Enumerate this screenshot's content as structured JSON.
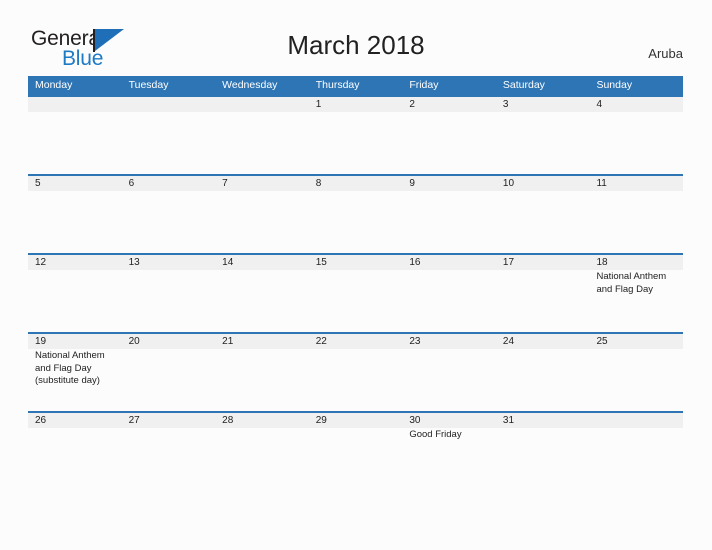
{
  "brand": {
    "name_part1": "General",
    "name_part2": "Blue",
    "flag_icon": "flag-icon"
  },
  "header": {
    "title": "March 2018",
    "country": "Aruba"
  },
  "colors": {
    "header_blue": "#2e75b6",
    "row_divider_blue": "#2e75b6",
    "daynum_band": "#f0f0f0",
    "logo_blue": "#1f7ac4",
    "page_background": "#fcfcfc"
  },
  "calendar": {
    "weekdays": [
      "Monday",
      "Tuesday",
      "Wednesday",
      "Thursday",
      "Friday",
      "Saturday",
      "Sunday"
    ],
    "weeks": [
      {
        "days": [
          {
            "num": "",
            "event": ""
          },
          {
            "num": "",
            "event": ""
          },
          {
            "num": "",
            "event": ""
          },
          {
            "num": "1",
            "event": ""
          },
          {
            "num": "2",
            "event": ""
          },
          {
            "num": "3",
            "event": ""
          },
          {
            "num": "4",
            "event": ""
          }
        ]
      },
      {
        "days": [
          {
            "num": "5",
            "event": ""
          },
          {
            "num": "6",
            "event": ""
          },
          {
            "num": "7",
            "event": ""
          },
          {
            "num": "8",
            "event": ""
          },
          {
            "num": "9",
            "event": ""
          },
          {
            "num": "10",
            "event": ""
          },
          {
            "num": "11",
            "event": ""
          }
        ]
      },
      {
        "days": [
          {
            "num": "12",
            "event": ""
          },
          {
            "num": "13",
            "event": ""
          },
          {
            "num": "14",
            "event": ""
          },
          {
            "num": "15",
            "event": ""
          },
          {
            "num": "16",
            "event": ""
          },
          {
            "num": "17",
            "event": ""
          },
          {
            "num": "18",
            "event": "National Anthem and Flag Day"
          }
        ]
      },
      {
        "days": [
          {
            "num": "19",
            "event": "National Anthem and Flag Day (substitute day)"
          },
          {
            "num": "20",
            "event": ""
          },
          {
            "num": "21",
            "event": ""
          },
          {
            "num": "22",
            "event": ""
          },
          {
            "num": "23",
            "event": ""
          },
          {
            "num": "24",
            "event": ""
          },
          {
            "num": "25",
            "event": ""
          }
        ]
      },
      {
        "days": [
          {
            "num": "26",
            "event": ""
          },
          {
            "num": "27",
            "event": ""
          },
          {
            "num": "28",
            "event": ""
          },
          {
            "num": "29",
            "event": ""
          },
          {
            "num": "30",
            "event": "Good Friday"
          },
          {
            "num": "31",
            "event": ""
          },
          {
            "num": "",
            "event": ""
          }
        ]
      }
    ]
  }
}
